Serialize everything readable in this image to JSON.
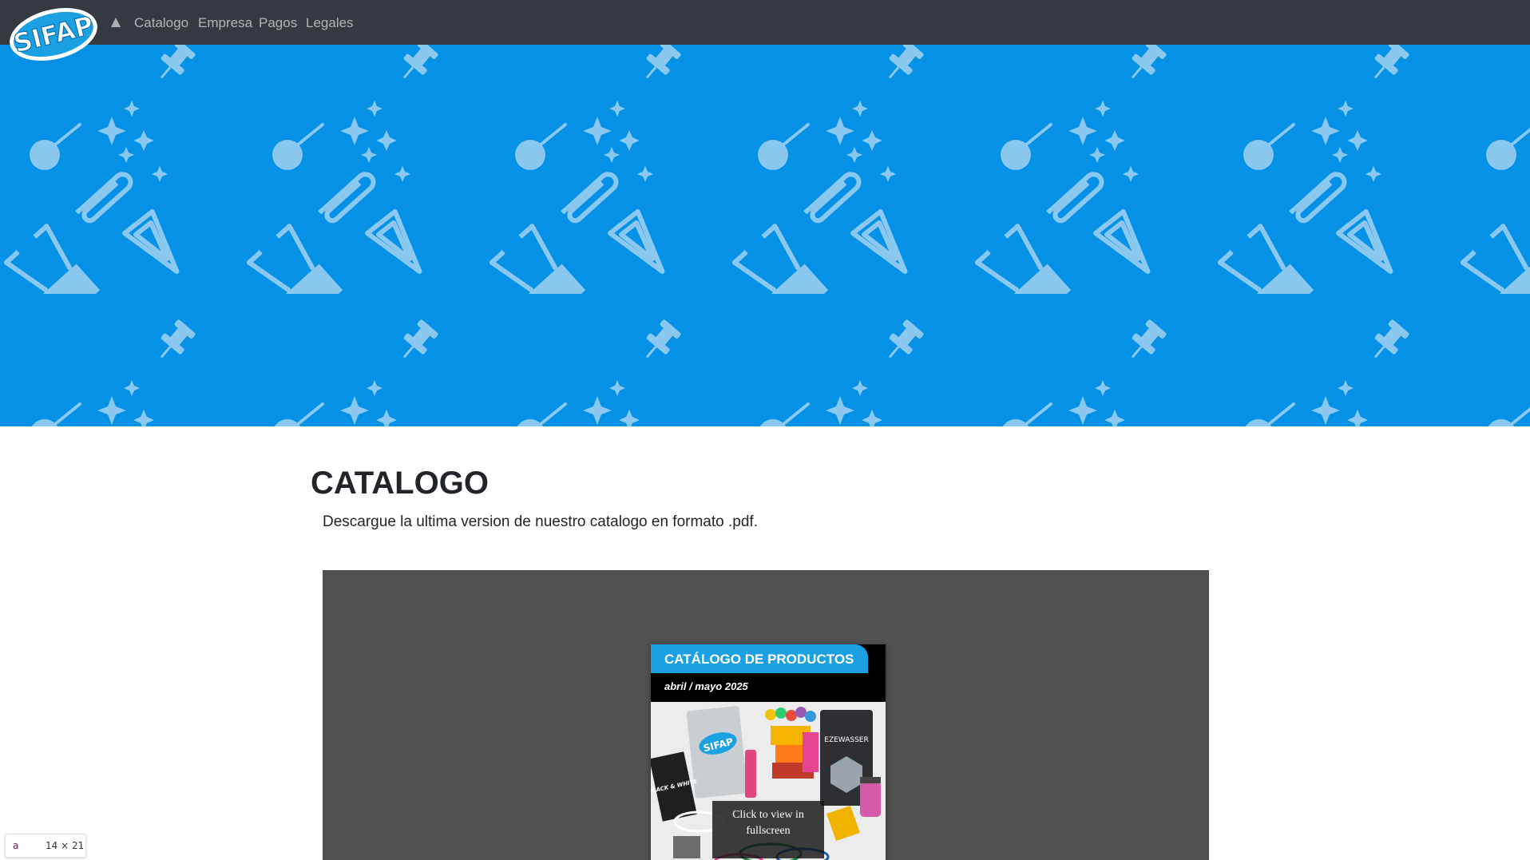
{
  "brand": {
    "logo_text": "SIFAP",
    "logo_fill": "#1ba0e2",
    "logo_outline": "#ffffff"
  },
  "nav": {
    "home_icon": "triangle-up-icon",
    "items": [
      {
        "label": "Catalogo"
      },
      {
        "label": "Empresa"
      },
      {
        "label": "Pagos"
      },
      {
        "label": "Legales"
      }
    ]
  },
  "hero": {
    "background": "#0592e6",
    "pattern_color": "#8bc8f0",
    "pattern_icons": [
      "pushpin-icon",
      "sparkle-icon",
      "round-pin-icon",
      "paperclip-icon",
      "binder-clip-icon",
      "triangle-clip-icon"
    ]
  },
  "page": {
    "title": "CATALOGO",
    "subtitle": "Descargue la ultima version de nuestro catalogo en formato .pdf."
  },
  "viewer": {
    "background": "#505050",
    "cover": {
      "title": "CATÁLOGO DE PRODUCTOS",
      "date": "abril / mayo 2025",
      "accent": "#1ba0e2",
      "product_labels": [
        "SIFAP",
        "BLACK & WHITE",
        "EZEWASSER"
      ]
    },
    "overlay_text": "Click to view in fullscreen"
  },
  "inspector_badge": {
    "tag": "a",
    "size": "14 × 21"
  }
}
